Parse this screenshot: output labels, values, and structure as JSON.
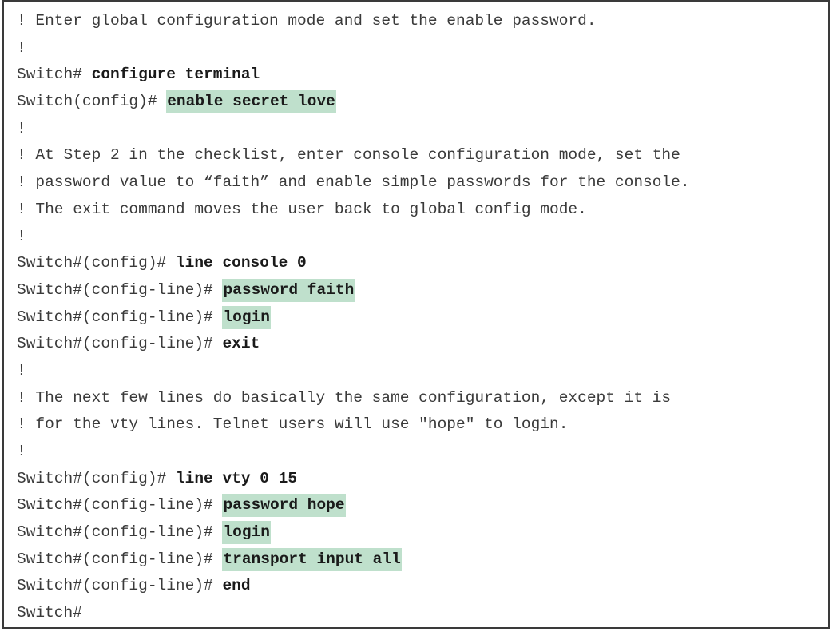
{
  "listing": {
    "lines": [
      {
        "prompt": "! Enter global configuration mode and set the enable password.",
        "command": "",
        "highlight": false
      },
      {
        "prompt": "!",
        "command": "",
        "highlight": false
      },
      {
        "prompt": "Switch# ",
        "command": "configure terminal",
        "highlight": false
      },
      {
        "prompt": "Switch(config)# ",
        "command": "enable secret love",
        "highlight": true
      },
      {
        "prompt": "!",
        "command": "",
        "highlight": false
      },
      {
        "prompt": "! At Step 2 in the checklist, enter console configuration mode, set the",
        "command": "",
        "highlight": false
      },
      {
        "prompt": "! password value to “faith” and enable simple passwords for the console.",
        "command": "",
        "highlight": false
      },
      {
        "prompt": "! The exit command moves the user back to global config mode.",
        "command": "",
        "highlight": false
      },
      {
        "prompt": "!",
        "command": "",
        "highlight": false
      },
      {
        "prompt": "Switch#(config)# ",
        "command": "line console 0",
        "highlight": false
      },
      {
        "prompt": "Switch#(config-line)# ",
        "command": "password faith",
        "highlight": true
      },
      {
        "prompt": "Switch#(config-line)# ",
        "command": "login",
        "highlight": true
      },
      {
        "prompt": "Switch#(config-line)# ",
        "command": "exit",
        "highlight": false
      },
      {
        "prompt": "!",
        "command": "",
        "highlight": false
      },
      {
        "prompt": "! The next few lines do basically the same configuration, except it is",
        "command": "",
        "highlight": false
      },
      {
        "prompt": "! for the vty lines. Telnet users will use \"hope\" to login.",
        "command": "",
        "highlight": false
      },
      {
        "prompt": "!",
        "command": "",
        "highlight": false
      },
      {
        "prompt": "Switch#(config)# ",
        "command": "line vty 0 15",
        "highlight": false
      },
      {
        "prompt": "Switch#(config-line)# ",
        "command": "password hope",
        "highlight": true
      },
      {
        "prompt": "Switch#(config-line)# ",
        "command": "login",
        "highlight": true
      },
      {
        "prompt": "Switch#(config-line)# ",
        "command": "transport input all",
        "highlight": true
      },
      {
        "prompt": "Switch#(config-line)# ",
        "command": "end",
        "highlight": false
      },
      {
        "prompt": "Switch#",
        "command": "",
        "highlight": false
      }
    ],
    "highlight_color": "#bfe0cc",
    "text_color": "#3a3a3a",
    "border_color": "#3a3a3a"
  }
}
